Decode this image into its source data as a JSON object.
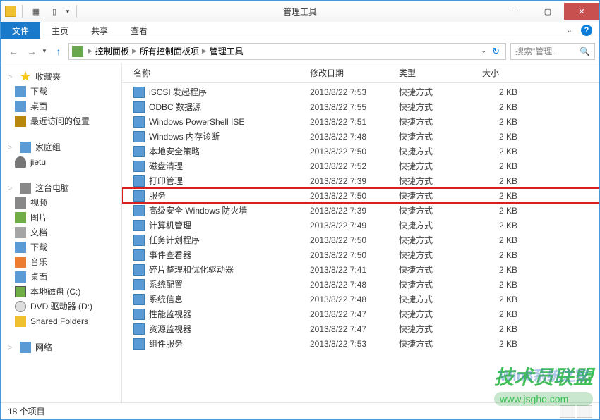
{
  "window": {
    "title": "管理工具"
  },
  "ribbon": {
    "file": "文件",
    "home": "主页",
    "share": "共享",
    "view": "查看"
  },
  "breadcrumb": {
    "items": [
      "控制面板",
      "所有控制面板项",
      "管理工具"
    ]
  },
  "search": {
    "placeholder": "搜索\"管理..."
  },
  "sidebar": {
    "favorites": {
      "label": "收藏夹",
      "items": [
        "下载",
        "桌面",
        "最近访问的位置"
      ]
    },
    "homegroup": {
      "label": "家庭组",
      "items": [
        "jietu"
      ]
    },
    "computer": {
      "label": "这台电脑",
      "items": [
        "视频",
        "图片",
        "文档",
        "下载",
        "音乐",
        "桌面",
        "本地磁盘 (C:)",
        "DVD 驱动器 (D:)",
        "Shared Folders"
      ]
    },
    "network": {
      "label": "网络"
    }
  },
  "columns": {
    "name": "名称",
    "date": "修改日期",
    "type": "类型",
    "size": "大小"
  },
  "files": [
    {
      "name": "iSCSI 发起程序",
      "date": "2013/8/22 7:53",
      "type": "快捷方式",
      "size": "2 KB"
    },
    {
      "name": "ODBC 数据源",
      "date": "2013/8/22 7:55",
      "type": "快捷方式",
      "size": "2 KB"
    },
    {
      "name": "Windows PowerShell ISE",
      "date": "2013/8/22 7:51",
      "type": "快捷方式",
      "size": "2 KB"
    },
    {
      "name": "Windows 内存诊断",
      "date": "2013/8/22 7:48",
      "type": "快捷方式",
      "size": "2 KB"
    },
    {
      "name": "本地安全策略",
      "date": "2013/8/22 7:50",
      "type": "快捷方式",
      "size": "2 KB"
    },
    {
      "name": "磁盘清理",
      "date": "2013/8/22 7:52",
      "type": "快捷方式",
      "size": "2 KB"
    },
    {
      "name": "打印管理",
      "date": "2013/8/22 7:39",
      "type": "快捷方式",
      "size": "2 KB"
    },
    {
      "name": "服务",
      "date": "2013/8/22 7:50",
      "type": "快捷方式",
      "size": "2 KB",
      "highlight": true
    },
    {
      "name": "高级安全 Windows 防火墙",
      "date": "2013/8/22 7:39",
      "type": "快捷方式",
      "size": "2 KB"
    },
    {
      "name": "计算机管理",
      "date": "2013/8/22 7:49",
      "type": "快捷方式",
      "size": "2 KB"
    },
    {
      "name": "任务计划程序",
      "date": "2013/8/22 7:50",
      "type": "快捷方式",
      "size": "2 KB"
    },
    {
      "name": "事件查看器",
      "date": "2013/8/22 7:50",
      "type": "快捷方式",
      "size": "2 KB"
    },
    {
      "name": "碎片整理和优化驱动器",
      "date": "2013/8/22 7:41",
      "type": "快捷方式",
      "size": "2 KB"
    },
    {
      "name": "系统配置",
      "date": "2013/8/22 7:48",
      "type": "快捷方式",
      "size": "2 KB"
    },
    {
      "name": "系统信息",
      "date": "2013/8/22 7:48",
      "type": "快捷方式",
      "size": "2 KB"
    },
    {
      "name": "性能监视器",
      "date": "2013/8/22 7:47",
      "type": "快捷方式",
      "size": "2 KB"
    },
    {
      "name": "资源监视器",
      "date": "2013/8/22 7:47",
      "type": "快捷方式",
      "size": "2 KB"
    },
    {
      "name": "组件服务",
      "date": "2013/8/22 7:53",
      "type": "快捷方式",
      "size": "2 KB"
    }
  ],
  "statusbar": {
    "count": "18 个项目"
  },
  "watermarks": {
    "main": "技术员联盟",
    "url": "www.jsgho.com",
    "bg": "Win8系统之家"
  }
}
